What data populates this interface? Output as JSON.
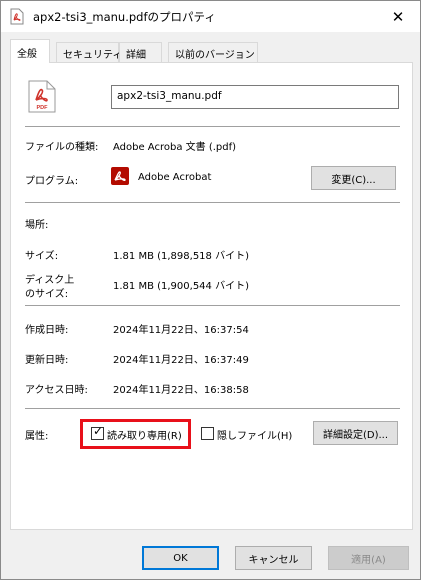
{
  "window": {
    "title": "apx2-tsi3_manu.pdfのプロパティ",
    "close_glyph": "✕"
  },
  "tabs": [
    {
      "label": "全般",
      "active": true
    },
    {
      "label": "セキュリティ",
      "active": false
    },
    {
      "label": "詳細",
      "active": false
    },
    {
      "label": "以前のバージョン",
      "active": false
    }
  ],
  "file": {
    "icon_label": "PDF",
    "name": "apx2-tsi3_manu.pdf"
  },
  "properties": {
    "type_label": "ファイルの種類:",
    "type_value": "Adobe Acroba 文書 (.pdf)",
    "program_label": "プログラム:",
    "program_value": "Adobe Acrobat",
    "change_button": "変更(C)...",
    "location_label": "場所:",
    "size_label": "サイズ:",
    "size_value": "1.81 MB (1,898,518 バイト)",
    "disk_size_label_1": "ディスク上",
    "disk_size_label_2": "のサイズ:",
    "disk_size_value": "1.81 MB (1,900,544 バイト)",
    "created_label": "作成日時:",
    "created_value": "2024年11月22日、16:37:54",
    "modified_label": "更新日時:",
    "modified_value": "2024年11月22日、16:37:49",
    "accessed_label": "アクセス日時:",
    "accessed_value": "2024年11月22日、16:38:58"
  },
  "attributes": {
    "label": "属性:",
    "readonly_label": "読み取り専用(R)",
    "readonly_checked": true,
    "hidden_label": "隠しファイル(H)",
    "hidden_checked": false,
    "advanced_button": "詳細設定(D)..."
  },
  "buttons": {
    "ok": "OK",
    "cancel": "キャンセル",
    "apply": "適用(A)"
  },
  "colors": {
    "accent": "#0078d7",
    "highlight": "#e8101a",
    "pdf_red": "#d0342c"
  }
}
